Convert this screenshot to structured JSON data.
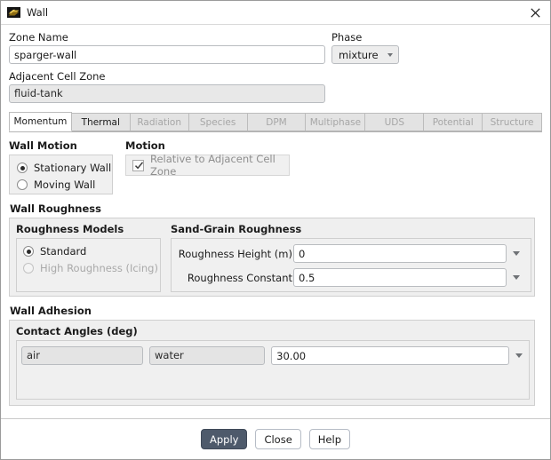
{
  "window": {
    "title": "Wall",
    "icon": "wall-icon",
    "close_icon": "close-icon"
  },
  "zone": {
    "name_label": "Zone Name",
    "name_value": "sparger-wall",
    "adjacent_label": "Adjacent Cell Zone",
    "adjacent_value": "fluid-tank"
  },
  "phase": {
    "label": "Phase",
    "value": "mixture"
  },
  "tabs": [
    {
      "label": "Momentum",
      "state": "active"
    },
    {
      "label": "Thermal",
      "state": "enabled"
    },
    {
      "label": "Radiation",
      "state": "disabled"
    },
    {
      "label": "Species",
      "state": "disabled"
    },
    {
      "label": "DPM",
      "state": "disabled"
    },
    {
      "label": "Multiphase",
      "state": "disabled"
    },
    {
      "label": "UDS",
      "state": "disabled"
    },
    {
      "label": "Potential",
      "state": "disabled"
    },
    {
      "label": "Structure",
      "state": "disabled"
    }
  ],
  "wall_motion": {
    "title": "Wall Motion",
    "options": [
      {
        "label": "Stationary Wall",
        "selected": true,
        "enabled": true
      },
      {
        "label": "Moving Wall",
        "selected": false,
        "enabled": true
      }
    ]
  },
  "motion": {
    "title": "Motion",
    "checkbox_label": "Relative to Adjacent Cell Zone",
    "checked": true,
    "enabled": false
  },
  "wall_roughness": {
    "title": "Wall Roughness",
    "models": {
      "title": "Roughness Models",
      "options": [
        {
          "label": "Standard",
          "selected": true,
          "enabled": true
        },
        {
          "label": "High Roughness (Icing)",
          "selected": false,
          "enabled": false
        }
      ]
    },
    "sand_grain": {
      "title": "Sand-Grain Roughness",
      "fields": [
        {
          "label": "Roughness Height (m)",
          "value": "0"
        },
        {
          "label": "Roughness Constant",
          "value": "0.5"
        }
      ]
    }
  },
  "wall_adhesion": {
    "title": "Wall Adhesion",
    "contact_angles": {
      "title": "Contact Angles (deg)",
      "phase_a": "air",
      "phase_b": "water",
      "angle": "30.00"
    }
  },
  "footer": {
    "apply": "Apply",
    "close": "Close",
    "help": "Help"
  },
  "colors": {
    "primary_button": "#4e5a6b",
    "panel_bg": "#efefef",
    "readonly_field": "#e8e8e8"
  }
}
